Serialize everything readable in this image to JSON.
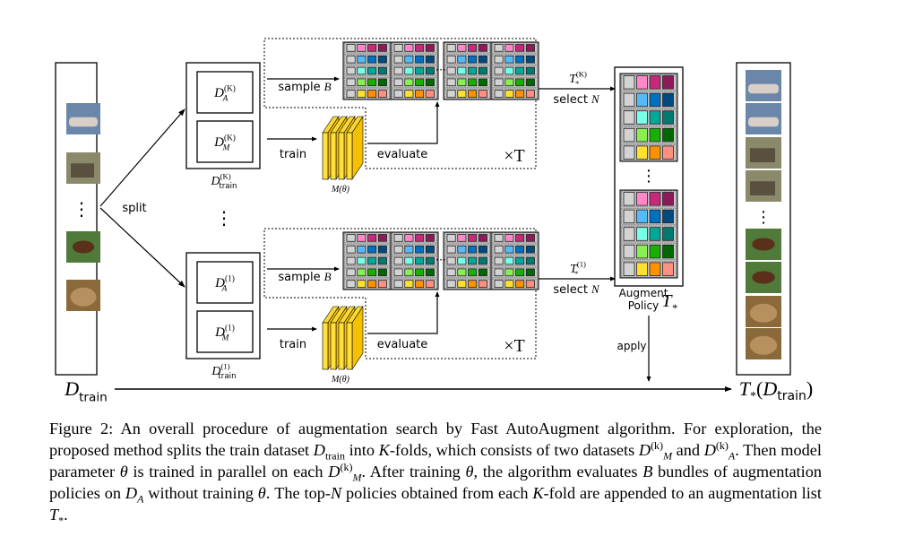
{
  "figure": {
    "split_label": "split",
    "dtrain_label": {
      "base": "D",
      "sub": "train"
    },
    "folds": [
      {
        "id": "K",
        "da": {
          "base": "D",
          "sup": "(K)",
          "sub": "A"
        },
        "dm": {
          "base": "D",
          "sup": "(K)",
          "sub": "M"
        },
        "dtrain": {
          "base": "D",
          "sup": "(K)",
          "sub": "train"
        },
        "sample_label": "sample",
        "sample_var": "B",
        "train_label": "train",
        "evaluate_label": "evaluate",
        "model_label": "M(θ)",
        "times_label": "×T",
        "select_top": {
          "base": "T",
          "sup": "(K)",
          "sub": "*"
        },
        "select_label": "select",
        "select_var": "N"
      },
      {
        "id": "1",
        "da": {
          "base": "D",
          "sup": "(1)",
          "sub": "A"
        },
        "dm": {
          "base": "D",
          "sup": "(1)",
          "sub": "M"
        },
        "dtrain": {
          "base": "D",
          "sup": "(1)",
          "sub": "train"
        },
        "sample_label": "sample",
        "sample_var": "B",
        "train_label": "train",
        "evaluate_label": "evaluate",
        "model_label": "M(θ)",
        "times_label": "×T",
        "select_top": {
          "base": "T",
          "sup": "(1)",
          "sub": "*"
        },
        "select_label": "select",
        "select_var": "N"
      }
    ],
    "ellipsis_h": "···",
    "ellipsis_v": "⋮",
    "policy_label_1": "Augment",
    "policy_label_2": "Policy",
    "policy_symbol": {
      "base": "T",
      "sub": "*"
    },
    "apply_label": "apply",
    "output_label": "T*(Dtrain)",
    "output_parts": {
      "t": "T",
      "tsub": "*",
      "open": "(",
      "d": "D",
      "dsub": "train",
      "close": ")"
    },
    "input_images": [
      "car",
      "truck",
      "horse",
      "frog"
    ],
    "output_images": [
      "car",
      "car",
      "truck",
      "truck",
      "horse",
      "horse",
      "frog",
      "frog"
    ],
    "palette": [
      [
        "#d3d3d3",
        "#ff88c8",
        "#c8287a",
        "#8e1a5a"
      ],
      [
        "#d3d3d3",
        "#55bbf8",
        "#0070c0",
        "#004a80"
      ],
      [
        "#d3d3d3",
        "#77ffe8",
        "#00a898",
        "#007a70"
      ],
      [
        "#d3d3d3",
        "#88f050",
        "#18b000",
        "#006800"
      ],
      [
        "#d3d3d3",
        "#ffe030",
        "#ff9000",
        "#ff9080"
      ]
    ],
    "model_color": "#f5c000"
  },
  "caption": [
    {
      "t": "Figure 2: An overall procedure of augmentation search by Fast AutoAugment algorithm. For exploration, the proposed method splits the train dataset "
    },
    {
      "t": "D",
      "i": true
    },
    {
      "t": "train",
      "sub": true
    },
    {
      "t": " into "
    },
    {
      "t": "K",
      "i": true
    },
    {
      "t": "-folds, which consists of two datasets "
    },
    {
      "t": "D",
      "i": true
    },
    {
      "t": "(k)",
      "sup": true
    },
    {
      "t": "M",
      "sub": true,
      "i": true
    },
    {
      "t": " and "
    },
    {
      "t": "D",
      "i": true
    },
    {
      "t": "(k)",
      "sup": true
    },
    {
      "t": "A",
      "sub": true,
      "i": true
    },
    {
      "t": ". Then model parameter "
    },
    {
      "t": "θ",
      "i": true
    },
    {
      "t": " is trained in parallel on each "
    },
    {
      "t": "D",
      "i": true
    },
    {
      "t": "(k)",
      "sup": true
    },
    {
      "t": "M",
      "sub": true,
      "i": true
    },
    {
      "t": ". After training "
    },
    {
      "t": "θ",
      "i": true
    },
    {
      "t": ", the algorithm evaluates "
    },
    {
      "t": "B",
      "i": true
    },
    {
      "t": " bundles of augmentation policies on "
    },
    {
      "t": "D",
      "i": true
    },
    {
      "t": "A",
      "sub": true,
      "i": true
    },
    {
      "t": " without training "
    },
    {
      "t": "θ",
      "i": true
    },
    {
      "t": ". The top-"
    },
    {
      "t": "N",
      "i": true
    },
    {
      "t": " policies obtained from each "
    },
    {
      "t": "K",
      "i": true
    },
    {
      "t": "-fold are appended to an augmentation list "
    },
    {
      "t": "T",
      "i": true
    },
    {
      "t": "*",
      "sub": true
    },
    {
      "t": "."
    }
  ]
}
